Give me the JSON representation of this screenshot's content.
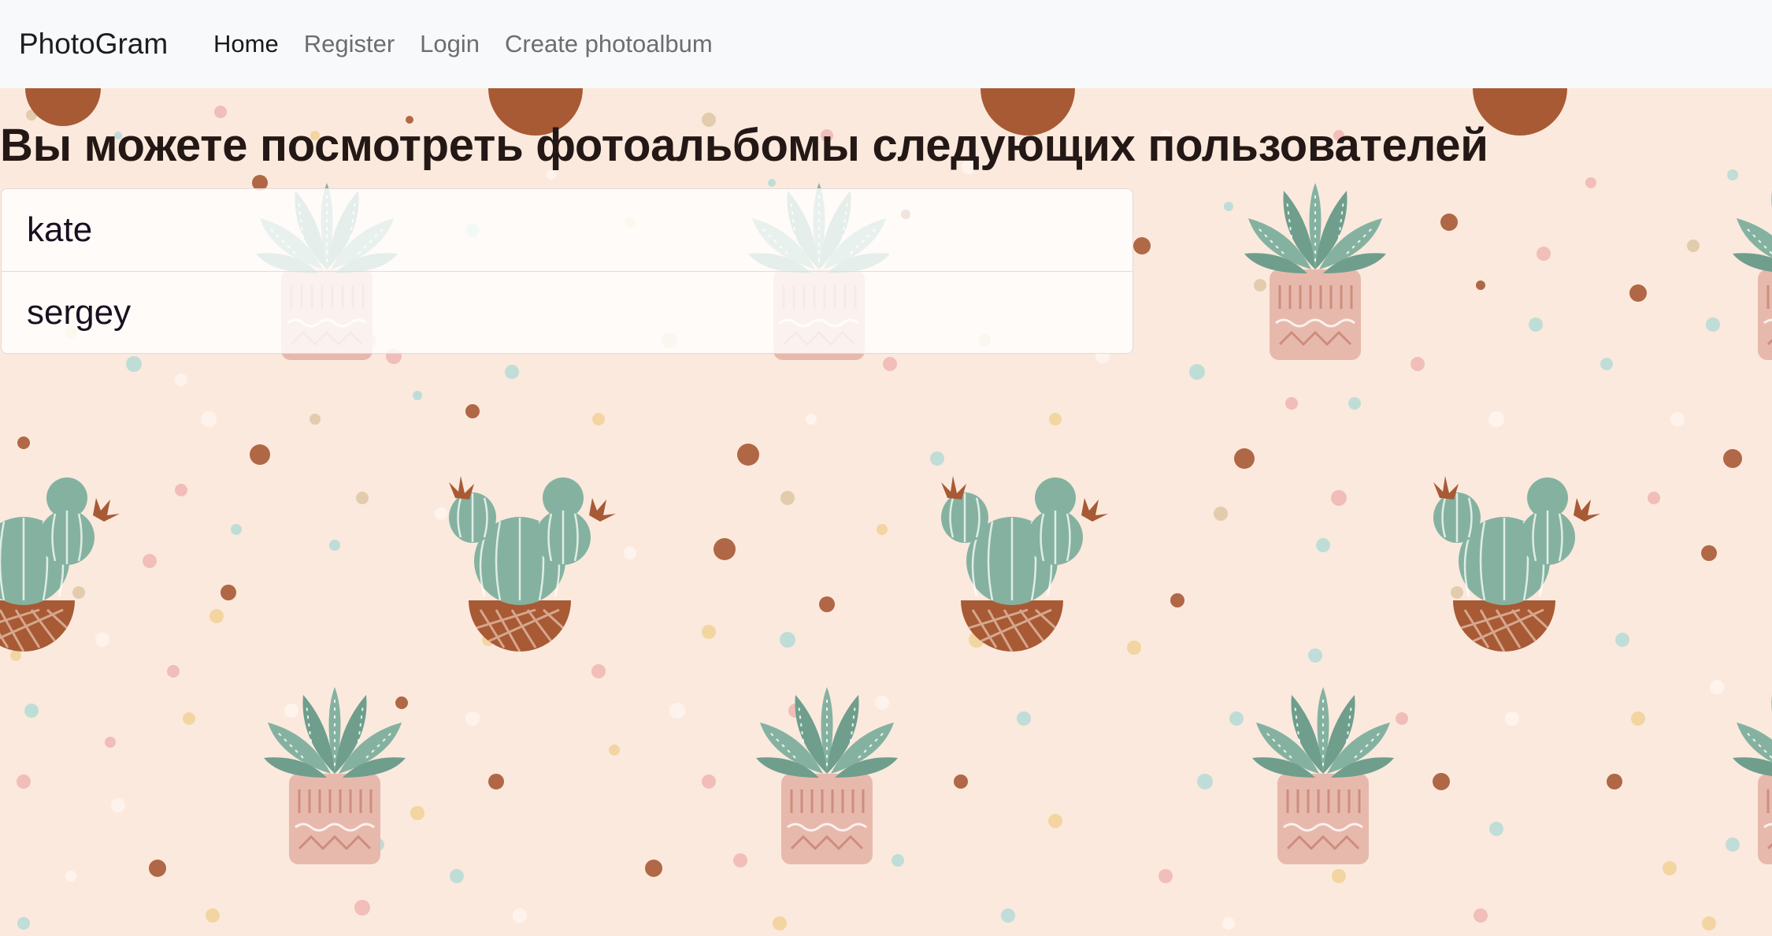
{
  "navbar": {
    "brand": "PhotoGram",
    "links": [
      {
        "label": "Home",
        "active": true
      },
      {
        "label": "Register",
        "active": false
      },
      {
        "label": "Login",
        "active": false
      },
      {
        "label": "Create photoalbum",
        "active": false
      }
    ]
  },
  "main": {
    "title": "Вы можете посмотреть фотоальбомы следующих пользователей",
    "users": [
      "kate",
      "sergey"
    ]
  },
  "colors": {
    "navbar_bg": "#f8f9fa",
    "page_bg": "#fbe9dd",
    "cactus_green": "#85b2a0",
    "pot_brown": "#a85a35",
    "pot_pink": "#e7b9ac"
  },
  "background": {
    "pattern": "cactus-and-dots-wallpaper"
  }
}
